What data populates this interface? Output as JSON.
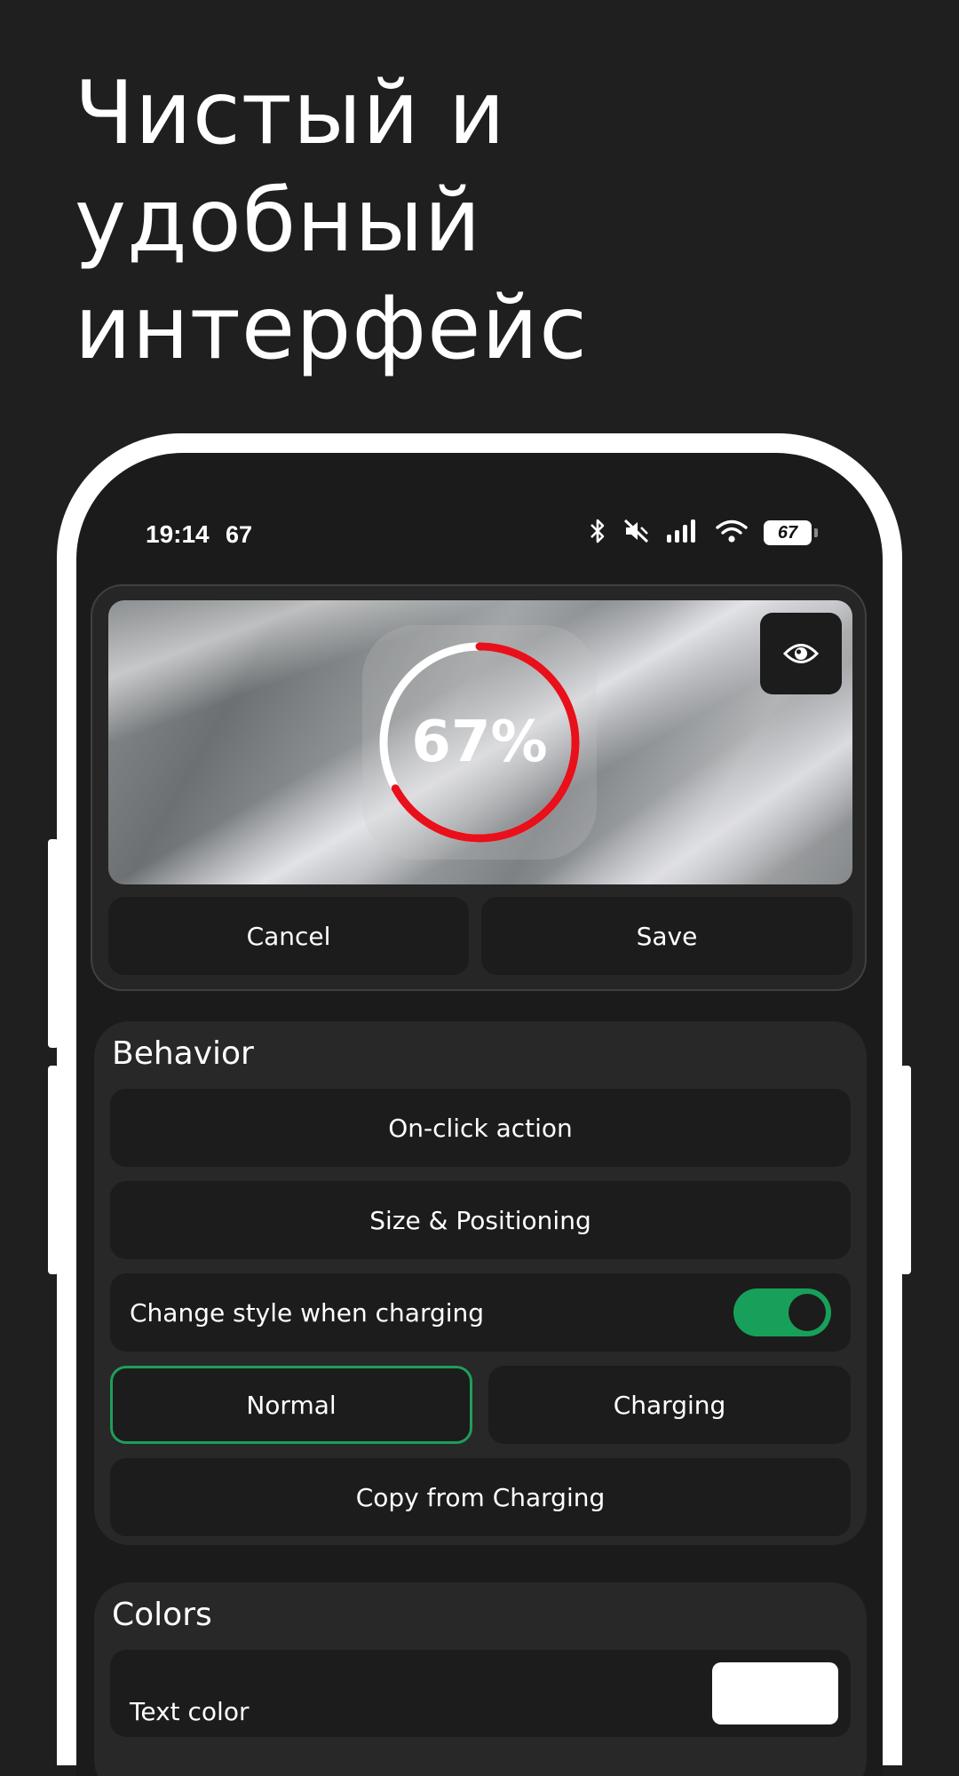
{
  "promo": {
    "headline_lines": [
      "Чистый и",
      "удобный",
      "интерфейс"
    ]
  },
  "status_bar": {
    "time": "19:14",
    "notification_count": "67",
    "battery_level": "67",
    "icons": [
      "bluetooth-icon",
      "mute-icon",
      "signal-icon",
      "wifi-icon",
      "battery-icon"
    ]
  },
  "editor": {
    "preview": {
      "percent_label": "67%",
      "battery_fraction": 0.67,
      "ring_color": "#e8101a",
      "ring_track_color": "#ffffff"
    },
    "eye_icon": "eye-icon",
    "cancel_label": "Cancel",
    "save_label": "Save"
  },
  "behavior": {
    "title": "Behavior",
    "on_click_label": "On-click action",
    "size_positioning_label": "Size & Positioning",
    "change_style_label": "Change style when charging",
    "change_style_enabled": true,
    "normal_label": "Normal",
    "charging_label": "Charging",
    "selected_mode": "Normal",
    "copy_label": "Copy from Charging"
  },
  "colors": {
    "title": "Colors",
    "text_color_label": "Text color",
    "text_color_value": "#ffffff"
  },
  "theme": {
    "accent": "#1f9d5b",
    "background": "#1f1f1f"
  }
}
